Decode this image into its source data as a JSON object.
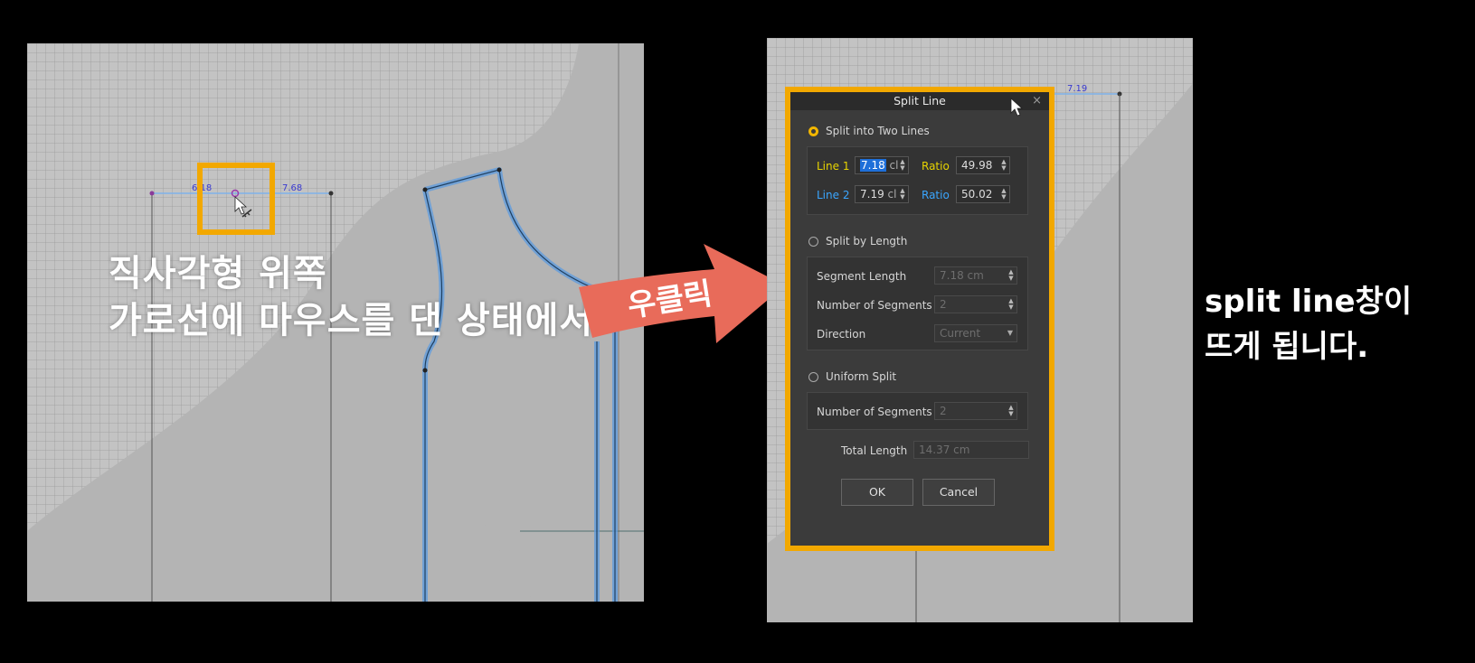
{
  "left_view": {
    "dim_left": "6.18",
    "dim_right": "7.68"
  },
  "captions": {
    "left_line1": "직사각형 위쪽",
    "left_line2": "가로선에 마우스를 댄 상태에서",
    "arrow_label": "우클릭",
    "right_line1": "split line창이",
    "right_line2": "뜨게 됩니다."
  },
  "right_view": {
    "dim_label": "7.19"
  },
  "dialog": {
    "title": "Split Line",
    "close_glyph": "×",
    "split_two": {
      "label": "Split into Two Lines",
      "selected": true,
      "line1_label": "Line 1",
      "line1_value": "7.18",
      "line1_unit": "cl",
      "line1_ratio_label": "Ratio",
      "line1_ratio": "49.98",
      "line2_label": "Line 2",
      "line2_value": "7.19",
      "line2_unit": "cl",
      "line2_ratio_label": "Ratio",
      "line2_ratio": "50.02"
    },
    "split_length": {
      "label": "Split by Length",
      "selected": false,
      "segment_length_label": "Segment Length",
      "segment_length_value": "7.18 cm",
      "num_segments_label": "Number of Segments",
      "num_segments_value": "2",
      "direction_label": "Direction",
      "direction_value": "Current"
    },
    "uniform": {
      "label": "Uniform Split",
      "selected": false,
      "num_segments_label": "Number of Segments",
      "num_segments_value": "2",
      "total_length_label": "Total Length",
      "total_length_value": "14.37 cm"
    },
    "ok_label": "OK",
    "cancel_label": "Cancel"
  },
  "colors": {
    "highlight": "#f2a800",
    "arrow": "#e86b5a",
    "seam_blue": "#5b9be0",
    "dim_line": "#7fb2ea"
  }
}
